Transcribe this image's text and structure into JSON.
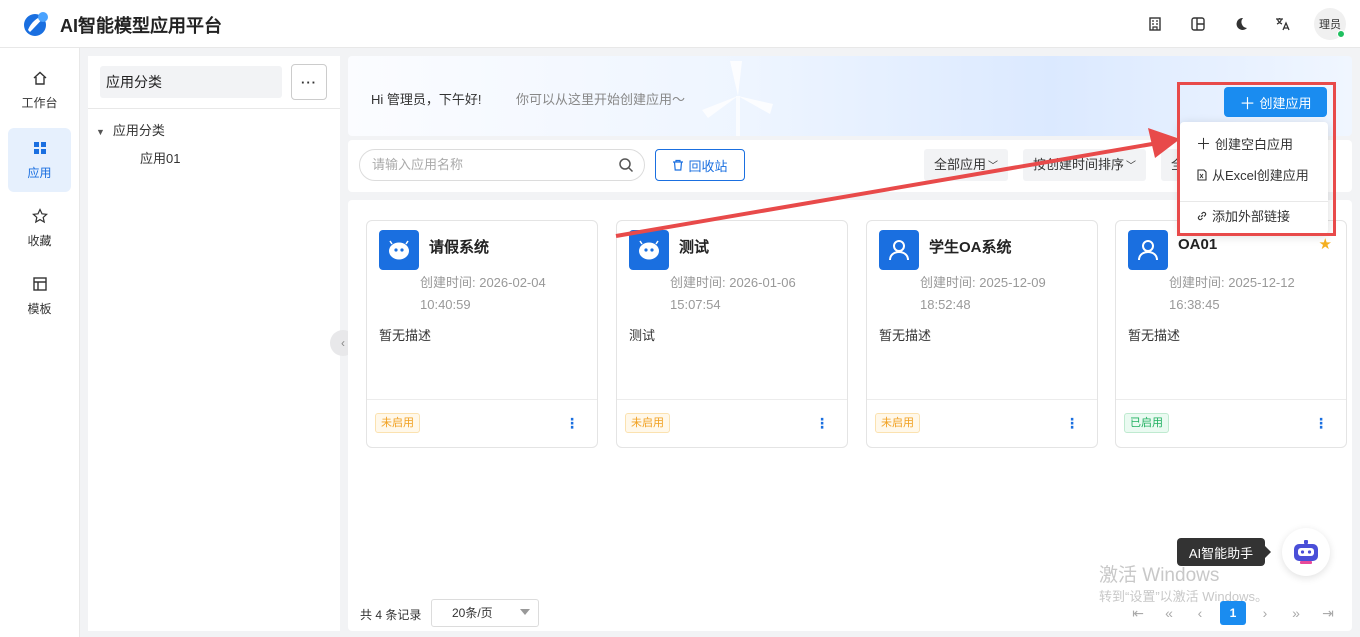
{
  "app": {
    "title": "AI智能模型应用平台",
    "avatar_text": "理员",
    "accent": "#1a6fe0"
  },
  "sidenav": [
    {
      "label": "工作台",
      "icon": "home-icon"
    },
    {
      "label": "应用",
      "icon": "apps-grid-icon",
      "active": true
    },
    {
      "label": "收藏",
      "icon": "star-outline-icon"
    },
    {
      "label": "模板",
      "icon": "template-icon"
    }
  ],
  "category": {
    "title": "应用分类",
    "more": "···",
    "tree_root": "应用分类",
    "tree_children": [
      "应用01"
    ]
  },
  "banner": {
    "greeting": "Hi 管理员，下午好!",
    "subtitle": "你可以从这里开始创建应用～",
    "create_label": "创建应用"
  },
  "toolbar": {
    "search_placeholder": "请输入应用名称",
    "recycle_label": "回收站",
    "filter_all": "全部应用",
    "sort_label": "按创建时间排序",
    "extra_label": "全"
  },
  "dropdown": {
    "blank": "创建空白应用",
    "excel": "从Excel创建应用",
    "link": "添加外部链接"
  },
  "cards": [
    {
      "name": "请假系统",
      "time_label": "创建时间: 2026-02-04",
      "time_clock": "10:40:59",
      "desc": "暂无描述",
      "status": "未启用",
      "enabled": false,
      "starred": false,
      "icon": "robot-icon"
    },
    {
      "name": "测试",
      "time_label": "创建时间: 2026-01-06",
      "time_clock": "15:07:54",
      "desc": "测试",
      "status": "未启用",
      "enabled": false,
      "starred": false,
      "icon": "robot-icon"
    },
    {
      "name": "学生OA系统",
      "time_label": "创建时间: 2025-12-09",
      "time_clock": "18:52:48",
      "desc": "暂无描述",
      "status": "未启用",
      "enabled": false,
      "starred": false,
      "icon": "user-icon"
    },
    {
      "name": "OA01",
      "time_label": "创建时间: 2025-12-12",
      "time_clock": "16:38:45",
      "desc": "暂无描述",
      "status": "已启用",
      "enabled": true,
      "starred": true,
      "icon": "user-icon"
    }
  ],
  "assistant": {
    "label": "AI智能助手"
  },
  "watermark": {
    "line1": "激活 Windows",
    "line2": "转到“设置”以激活 Windows。"
  },
  "pagination": {
    "total": "共 4 条记录",
    "page_size": "20条/页",
    "current_page": "1"
  }
}
